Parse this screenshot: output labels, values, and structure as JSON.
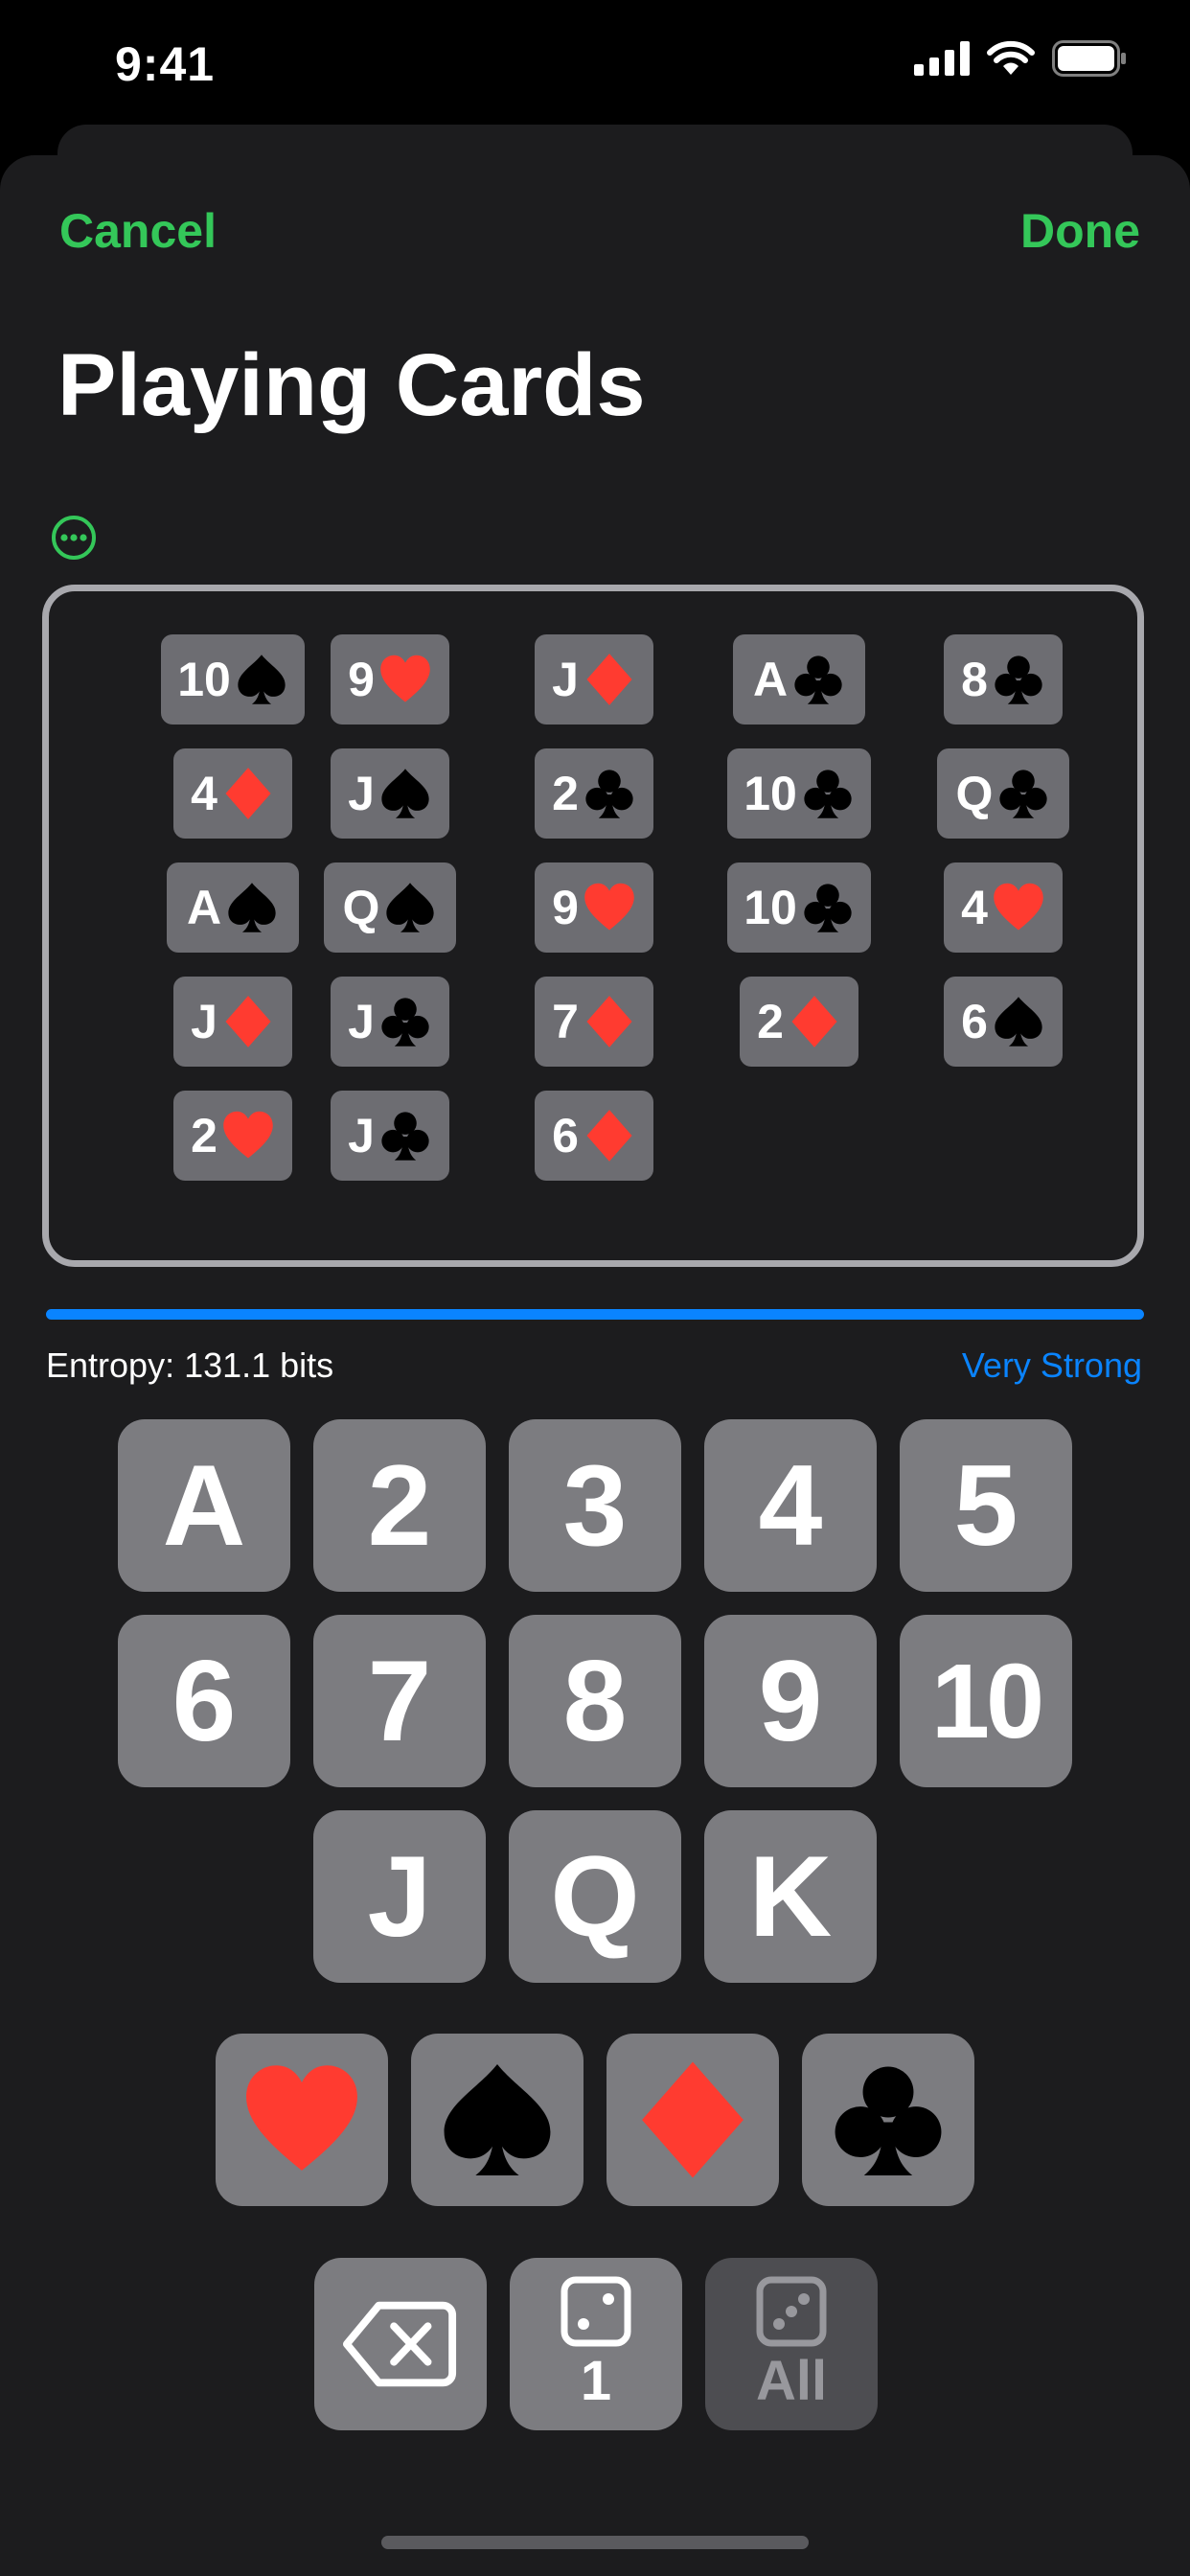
{
  "status": {
    "time": "9:41"
  },
  "nav": {
    "cancel": "Cancel",
    "done": "Done",
    "title": "Playing Cards"
  },
  "cards": [
    {
      "rank": "10",
      "suit": "spade"
    },
    {
      "rank": "9",
      "suit": "heart"
    },
    {
      "rank": "J",
      "suit": "diamond"
    },
    {
      "rank": "A",
      "suit": "club"
    },
    {
      "rank": "8",
      "suit": "club"
    },
    {
      "rank": "4",
      "suit": "diamond"
    },
    {
      "rank": "J",
      "suit": "spade"
    },
    {
      "rank": "2",
      "suit": "club"
    },
    {
      "rank": "10",
      "suit": "club"
    },
    {
      "rank": "Q",
      "suit": "club"
    },
    {
      "rank": "A",
      "suit": "spade"
    },
    {
      "rank": "Q",
      "suit": "spade"
    },
    {
      "rank": "9",
      "suit": "heart"
    },
    {
      "rank": "10",
      "suit": "club"
    },
    {
      "rank": "4",
      "suit": "heart"
    },
    {
      "rank": "J",
      "suit": "diamond"
    },
    {
      "rank": "J",
      "suit": "club"
    },
    {
      "rank": "7",
      "suit": "diamond"
    },
    {
      "rank": "2",
      "suit": "diamond"
    },
    {
      "rank": "6",
      "suit": "spade"
    },
    {
      "rank": "2",
      "suit": "heart"
    },
    {
      "rank": "J",
      "suit": "club"
    },
    {
      "rank": "6",
      "suit": "diamond"
    }
  ],
  "entropy": {
    "label": "Entropy: 131.1 bits",
    "strength": "Very Strong",
    "level": 1.0
  },
  "rank_keys": [
    "A",
    "2",
    "3",
    "4",
    "5",
    "6",
    "7",
    "8",
    "9",
    "10",
    "J",
    "Q",
    "K"
  ],
  "suit_keys": [
    "heart",
    "spade",
    "diamond",
    "club"
  ],
  "action_keys": {
    "one_label": "1",
    "all_label": "All"
  },
  "colors": {
    "accent": "#34c759",
    "red_suit": "#ff3b30",
    "black_suit": "#000000",
    "entropy": "#0a84ff"
  },
  "icons": {
    "more": "ellipsis-circle-icon",
    "delete": "delete-left-icon",
    "die": "die-icon"
  }
}
